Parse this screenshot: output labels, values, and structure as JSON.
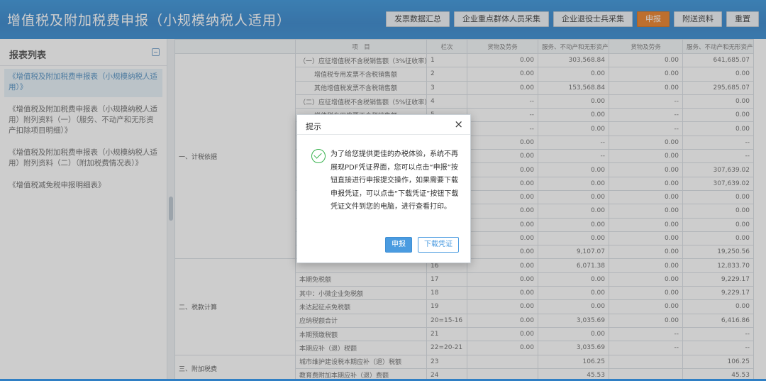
{
  "header": {
    "title": "增值税及附加税费申报（小规模纳税人适用）",
    "buttons": [
      "发票数据汇总",
      "企业重点群体人员采集",
      "企业退役士兵采集",
      "申报",
      "附送资料",
      "重置"
    ]
  },
  "sidebar": {
    "title": "报表列表",
    "items": [
      "《增值税及附加税费申报表（小规模纳税人适用）》",
      "《增值税及附加税费申报表（小规模纳税人适用）附列资料（一）（服务、不动产和无形资产扣除项目明细）》",
      "《增值税及附加税费申报表（小规模纳税人适用）附列资料（二）（附加税费情况表）》",
      "《增值税减免税申报明细表》"
    ]
  },
  "table": {
    "header": [
      "项　目",
      "栏次",
      "货物及劳务",
      "服务、不动产和无形资产",
      "货物及劳务",
      "服务、不动产和无形资产"
    ],
    "section1": "一、计税依据",
    "section2": "二、税款计算",
    "section3": "三、附加税费",
    "rows": [
      {
        "item": "（一）应征增值税不含税销售额（3%征收率）",
        "line": "1",
        "c1": "0.00",
        "c2": "303,568.84",
        "c3": "0.00",
        "c4": "641,685.07"
      },
      {
        "item": "增值税专用发票不含税销售额",
        "line": "2",
        "c1": "0.00",
        "c2": "0.00",
        "c3": "0.00",
        "c4": "0.00"
      },
      {
        "item": "其他增值税发票不含税销售额",
        "line": "3",
        "c1": "0.00",
        "c2": "153,568.84",
        "c3": "0.00",
        "c4": "295,685.07"
      },
      {
        "item": "（二）应征增值税不含税销售额（5%征收率）",
        "line": "4",
        "c1": "--",
        "c2": "0.00",
        "c3": "--",
        "c4": "0.00"
      },
      {
        "item": "增值税专用发票不含税销售额",
        "line": "5",
        "c1": "--",
        "c2": "0.00",
        "c3": "--",
        "c4": "0.00"
      },
      {
        "item": "",
        "line": "",
        "c1": "--",
        "c2": "0.00",
        "c3": "--",
        "c4": "0.00"
      },
      {
        "item": "",
        "line": "",
        "c1": "0.00",
        "c2": "--",
        "c3": "0.00",
        "c4": "--"
      },
      {
        "item": "",
        "line": "",
        "c1": "0.00",
        "c2": "--",
        "c3": "0.00",
        "c4": "--"
      },
      {
        "item": "",
        "line": "",
        "c1": "0.00",
        "c2": "0.00",
        "c3": "0.00",
        "c4": "307,639.02"
      },
      {
        "item": "",
        "line": "",
        "c1": "0.00",
        "c2": "0.00",
        "c3": "0.00",
        "c4": "307,639.02"
      },
      {
        "item": "",
        "line": "",
        "c1": "0.00",
        "c2": "0.00",
        "c3": "0.00",
        "c4": "0.00"
      },
      {
        "item": "",
        "line": "",
        "c1": "0.00",
        "c2": "0.00",
        "c3": "0.00",
        "c4": "0.00"
      },
      {
        "item": "",
        "line": "",
        "c1": "0.00",
        "c2": "0.00",
        "c3": "0.00",
        "c4": "0.00"
      },
      {
        "item": "",
        "line": "",
        "c1": "0.00",
        "c2": "0.00",
        "c3": "0.00",
        "c4": "0.00"
      },
      {
        "item": "",
        "line": "",
        "c1": "0.00",
        "c2": "9,107.07",
        "c3": "0.00",
        "c4": "19,250.56"
      },
      {
        "item": "",
        "line": "16",
        "c1": "0.00",
        "c2": "6,071.38",
        "c3": "0.00",
        "c4": "12,833.70"
      },
      {
        "item": "本期免税额",
        "line": "17",
        "c1": "0.00",
        "c2": "0.00",
        "c3": "0.00",
        "c4": "9,229.17"
      },
      {
        "item": "其中：小微企业免税额",
        "line": "18",
        "c1": "0.00",
        "c2": "0.00",
        "c3": "0.00",
        "c4": "9,229.17"
      },
      {
        "item": "未达起征点免税额",
        "line": "19",
        "c1": "0.00",
        "c2": "0.00",
        "c3": "0.00",
        "c4": "0.00"
      },
      {
        "item": "应纳税额合计",
        "line": "20=15-16",
        "c1": "0.00",
        "c2": "3,035.69",
        "c3": "0.00",
        "c4": "6,416.86"
      },
      {
        "item": "本期预缴税额",
        "line": "21",
        "c1": "0.00",
        "c2": "0.00",
        "c3": "--",
        "c4": "--"
      },
      {
        "item": "本期应补（退）税额",
        "line": "22=20-21",
        "c1": "0.00",
        "c2": "3,035.69",
        "c3": "--",
        "c4": "--"
      },
      {
        "item": "城市维护建设税本期应补（退）税额",
        "line": "23",
        "c1": "",
        "c2": "106.25",
        "c3": "",
        "c4": "106.25"
      },
      {
        "item": "教育费附加本期应补（退）费额",
        "line": "24",
        "c1": "",
        "c2": "45.53",
        "c3": "",
        "c4": "45.53"
      }
    ]
  },
  "modal": {
    "title": "提示",
    "close": "×",
    "message": "为了给您提供更佳的办税体验，系统不再展现PDF凭证界面，您可以点击“申报”按钮直接进行申报提交操作，如果需要下载申报凭证，可以点击“下载凭证”按钮下载凭证文件到您的电脑，进行查看打印。",
    "buttons": {
      "submit": "申报",
      "download": "下载凭证"
    }
  }
}
